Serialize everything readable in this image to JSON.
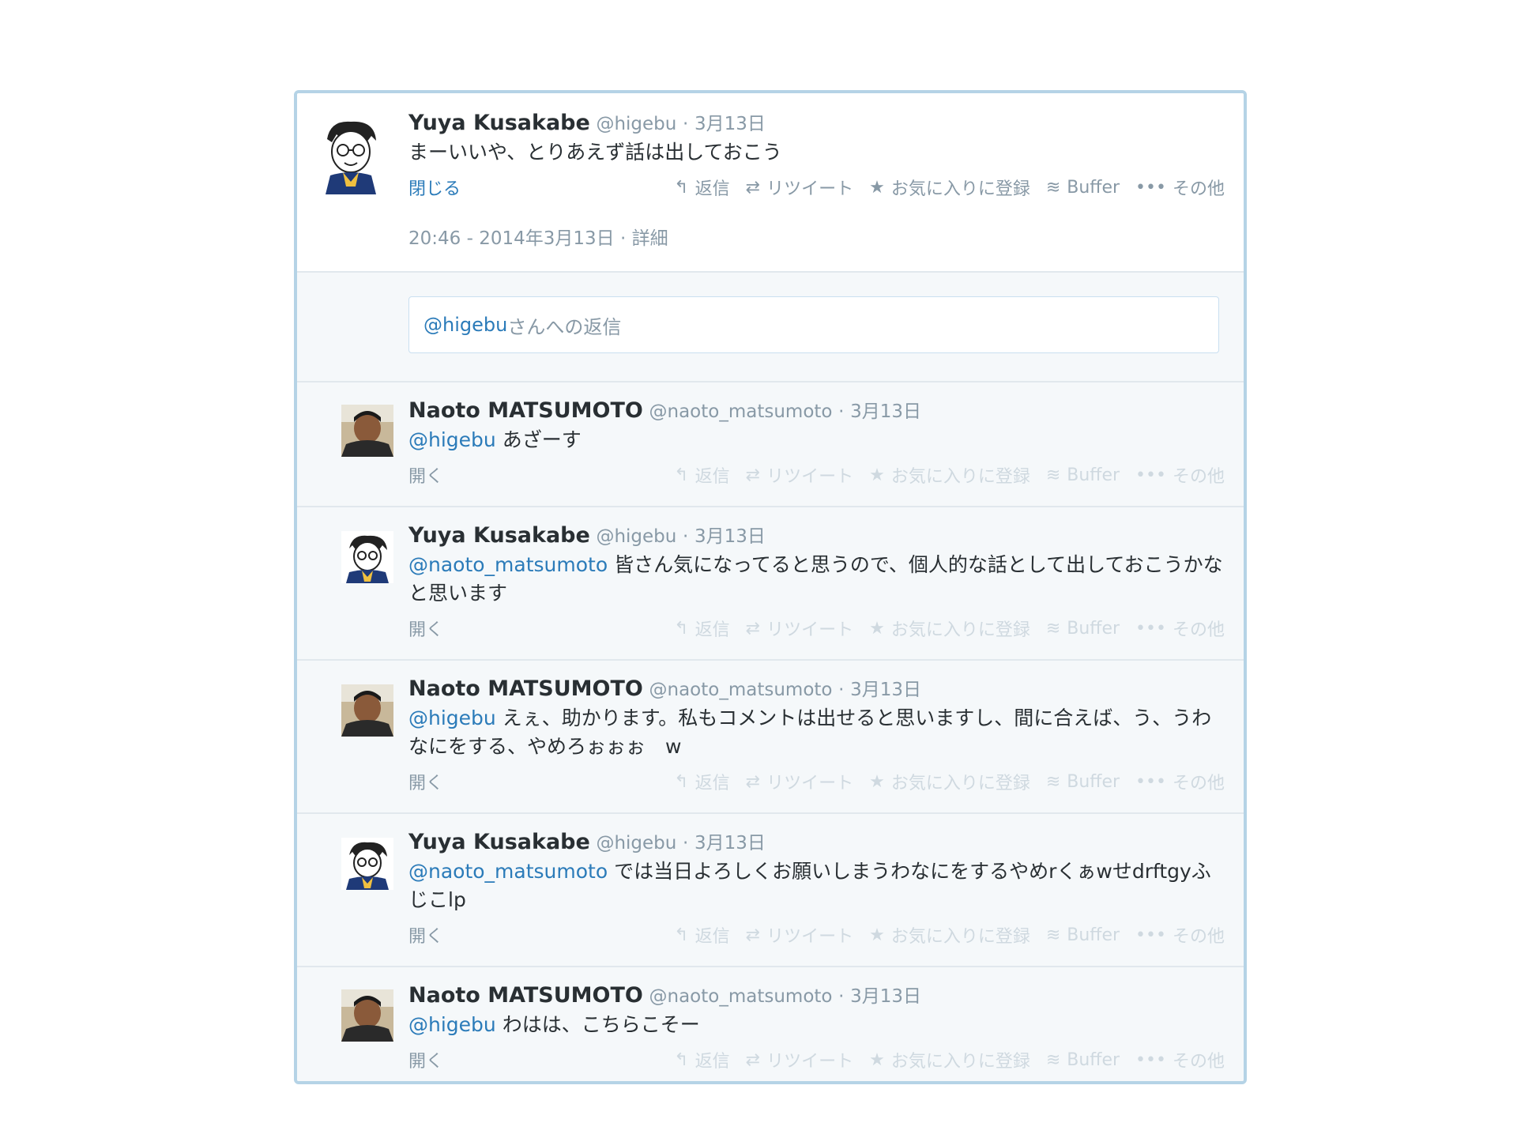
{
  "conversation": {
    "main_tweet": {
      "name": "Yuya Kusakabe",
      "handle": "@higebu",
      "separator": "·",
      "date": "3月13日",
      "text": "まーいいや、とりあえず話は出しておこう",
      "toggle": "閉じる",
      "timestamp": "20:46 - 2014年3月13日 · 詳細"
    },
    "actions": {
      "reply": "返信",
      "retweet": "リツイート",
      "favorite": "お気に入りに登録",
      "buffer": "Buffer",
      "more": "その他"
    },
    "reply_box": {
      "mention": "@higebu",
      "placeholder": " さんへの返信"
    },
    "replies": [
      {
        "name": "Naoto MATSUMOTO",
        "handle": "@naoto_matsumoto",
        "separator": "·",
        "date": "3月13日",
        "mention": "@higebu",
        "text": " あざーす",
        "toggle": "開く"
      },
      {
        "name": "Yuya Kusakabe",
        "handle": "@higebu",
        "separator": "·",
        "date": "3月13日",
        "mention": "@naoto_matsumoto",
        "text": " 皆さん気になってると思うので、個人的な話として出しておこうかなと思います",
        "toggle": "開く"
      },
      {
        "name": "Naoto MATSUMOTO",
        "handle": "@naoto_matsumoto",
        "separator": "·",
        "date": "3月13日",
        "mention": "@higebu",
        "text": " えぇ、助かります。私もコメントは出せると思いますし、間に合えば、う、うわなにをする、やめろぉぉぉ　w",
        "toggle": "開く"
      },
      {
        "name": "Yuya Kusakabe",
        "handle": "@higebu",
        "separator": "·",
        "date": "3月13日",
        "mention": "@naoto_matsumoto",
        "text": " では当日よろしくお願いしまうわなにをするやめrくぁwせdrftgyふじこlp",
        "toggle": "開く"
      },
      {
        "name": "Naoto MATSUMOTO",
        "handle": "@naoto_matsumoto",
        "separator": "·",
        "date": "3月13日",
        "mention": "@higebu",
        "text": " わはは、こちらこそー",
        "toggle": "開く"
      }
    ],
    "icons": {
      "reply": "reply-arrow-icon",
      "retweet": "retweet-icon",
      "favorite": "star-icon",
      "buffer": "buffer-stack-icon",
      "more": "ellipsis-icon"
    },
    "colors": {
      "link": "#2b7bb9",
      "muted": "#8899a6",
      "frame": "#b5d3e6",
      "background": "#f5f8fa"
    }
  }
}
